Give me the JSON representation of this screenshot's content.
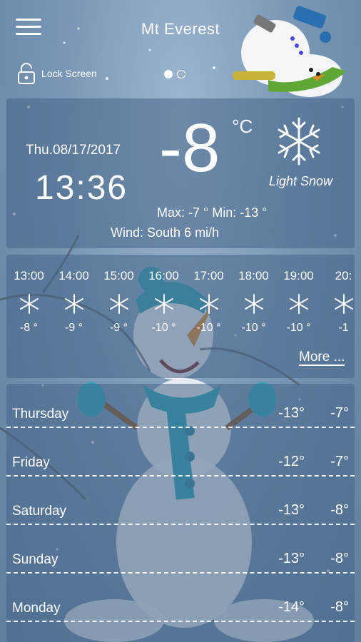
{
  "header": {
    "title": "Mt Everest",
    "lock_label": "Lock Screen"
  },
  "current": {
    "date": "Thu.08/17/2017",
    "time": "13:36",
    "temperature": "-8",
    "unit": "°C",
    "condition": "Light Snow",
    "max_min": "Max: -7 °  Min: -13 °",
    "wind": "Wind: South    6 mi/h"
  },
  "hourly": [
    {
      "time": "13:00",
      "temp": "-8 °",
      "icon": "snowflake-icon"
    },
    {
      "time": "14:00",
      "temp": "-9 °",
      "icon": "snowflake-icon"
    },
    {
      "time": "15:00",
      "temp": "-9 °",
      "icon": "snowflake-icon"
    },
    {
      "time": "16:00",
      "temp": "-10 °",
      "icon": "snowflake-icon"
    },
    {
      "time": "17:00",
      "temp": "-10 °",
      "icon": "snowflake-icon"
    },
    {
      "time": "18:00",
      "temp": "-10 °",
      "icon": "snowflake-icon"
    },
    {
      "time": "19:00",
      "temp": "-10 °",
      "icon": "snowflake-icon"
    },
    {
      "time": "20:",
      "temp": "-1",
      "icon": "snowflake-icon"
    }
  ],
  "more_label": "More ...",
  "daily": [
    {
      "day": "Thursday",
      "high": "-13°",
      "low": "-7°"
    },
    {
      "day": "Friday",
      "high": "-12°",
      "low": "-7°"
    },
    {
      "day": "Saturday",
      "high": "-13°",
      "low": "-8°"
    },
    {
      "day": "Sunday",
      "high": "-13°",
      "low": "-8°"
    },
    {
      "day": "Monday",
      "high": "-14°",
      "low": "-8°"
    }
  ],
  "colors": {
    "panel": "#46648780",
    "background": "#7a98b6",
    "text": "#ffffff"
  }
}
